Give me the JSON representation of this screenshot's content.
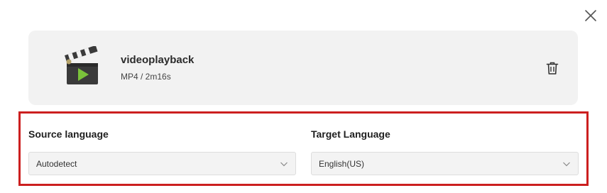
{
  "dialog": {
    "close_icon": "close-icon"
  },
  "file": {
    "name": "videoplayback",
    "meta": "MP4 / 2m16s",
    "thumbnail_icon": "clapperboard-icon",
    "delete_icon": "trash-icon"
  },
  "source_language": {
    "label": "Source language",
    "value": "Autodetect",
    "chevron_icon": "chevron-down-icon"
  },
  "target_language": {
    "label": "Target Language",
    "value": "English(US)",
    "chevron_icon": "chevron-down-icon"
  },
  "colors": {
    "highlight_border": "#cc1f1f",
    "card_background": "#f2f2f2",
    "select_background": "#f3f3f3"
  }
}
